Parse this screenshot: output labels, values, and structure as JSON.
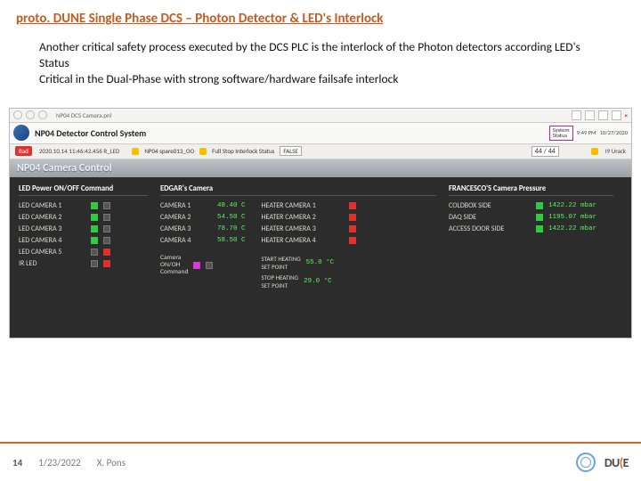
{
  "title": "proto. DUNE Single Phase DCS – Photon Detector & LED's Interlock",
  "body_lines": [
    "Another critical safety process executed by the DCS PLC is the interlock of the Photon detectors according LED's Status",
    "Critical in the Dual-Phase with strong software/hardware failsafe interlock"
  ],
  "app": {
    "toolbar_label": "NP04 DCS Camera.pnl",
    "close_icon": "×",
    "system_name": "NP04 Detector Control System",
    "badge": "Bad",
    "badge_time": "2020.10.14 11:46:42.456 R_LED",
    "spare": "NP04 spare013_OO",
    "interlock_label": "Full Stop Interlock Status",
    "interlock_value": "FALSE",
    "counter": "44 / 44",
    "sys_status_label": "System\nStatus",
    "pm": "9:49 PM",
    "date": "10/27/2020",
    "urack": "I9 Urack",
    "panel_title": "NP04 Camera Control"
  },
  "columns": {
    "led": {
      "title": "LED  Power ON/OFF Command",
      "rows": [
        {
          "label": "LED CAMERA 1",
          "on": true
        },
        {
          "label": "LED CAMERA 2",
          "on": true
        },
        {
          "label": "LED CAMERA 3",
          "on": true
        },
        {
          "label": "LED CAMERA 4",
          "on": true
        },
        {
          "label": "LED CAMERA 5",
          "on": false
        },
        {
          "label": "IR LED",
          "on": false
        }
      ]
    },
    "edgar": {
      "title": "EDGAR's Camera",
      "rows": [
        {
          "label": "CAMERA 1",
          "val": "48.40 C"
        },
        {
          "label": "CAMERA 2",
          "val": "54.50 C"
        },
        {
          "label": "CAMERA 3",
          "val": "78.70 C"
        },
        {
          "label": "CAMERA 4",
          "val": "58.50 C"
        }
      ],
      "cmd_label": "Camera\nON/OH\nCommand",
      "heating_rows": [
        {
          "label": "HEATER CAMERA 1"
        },
        {
          "label": "HEATER CAMERA 2"
        },
        {
          "label": "HEATER CAMERA 3"
        },
        {
          "label": "HEATER CAMERA 4"
        }
      ],
      "set_points": [
        {
          "label": "START HEATING\nSET POINT",
          "val": "55.0 °C"
        },
        {
          "label": "STOP HEATING\nSET POINT",
          "val": "29.0 °C"
        }
      ]
    },
    "press": {
      "title": "FRANCESCO'S Camera Pressure",
      "rows": [
        {
          "label": "COLDBOX SIDE",
          "val": "1422.22 mbar"
        },
        {
          "label": "DAQ SIDE",
          "val": "1195.07 mbar"
        },
        {
          "label": "ACCESS DOOR SIDE",
          "val": "1422.22 mbar"
        }
      ]
    }
  },
  "footer": {
    "page": "14",
    "date": "1/23/2022",
    "author": "X. Pons",
    "dune_a": "DU",
    "dune_b": "E"
  }
}
